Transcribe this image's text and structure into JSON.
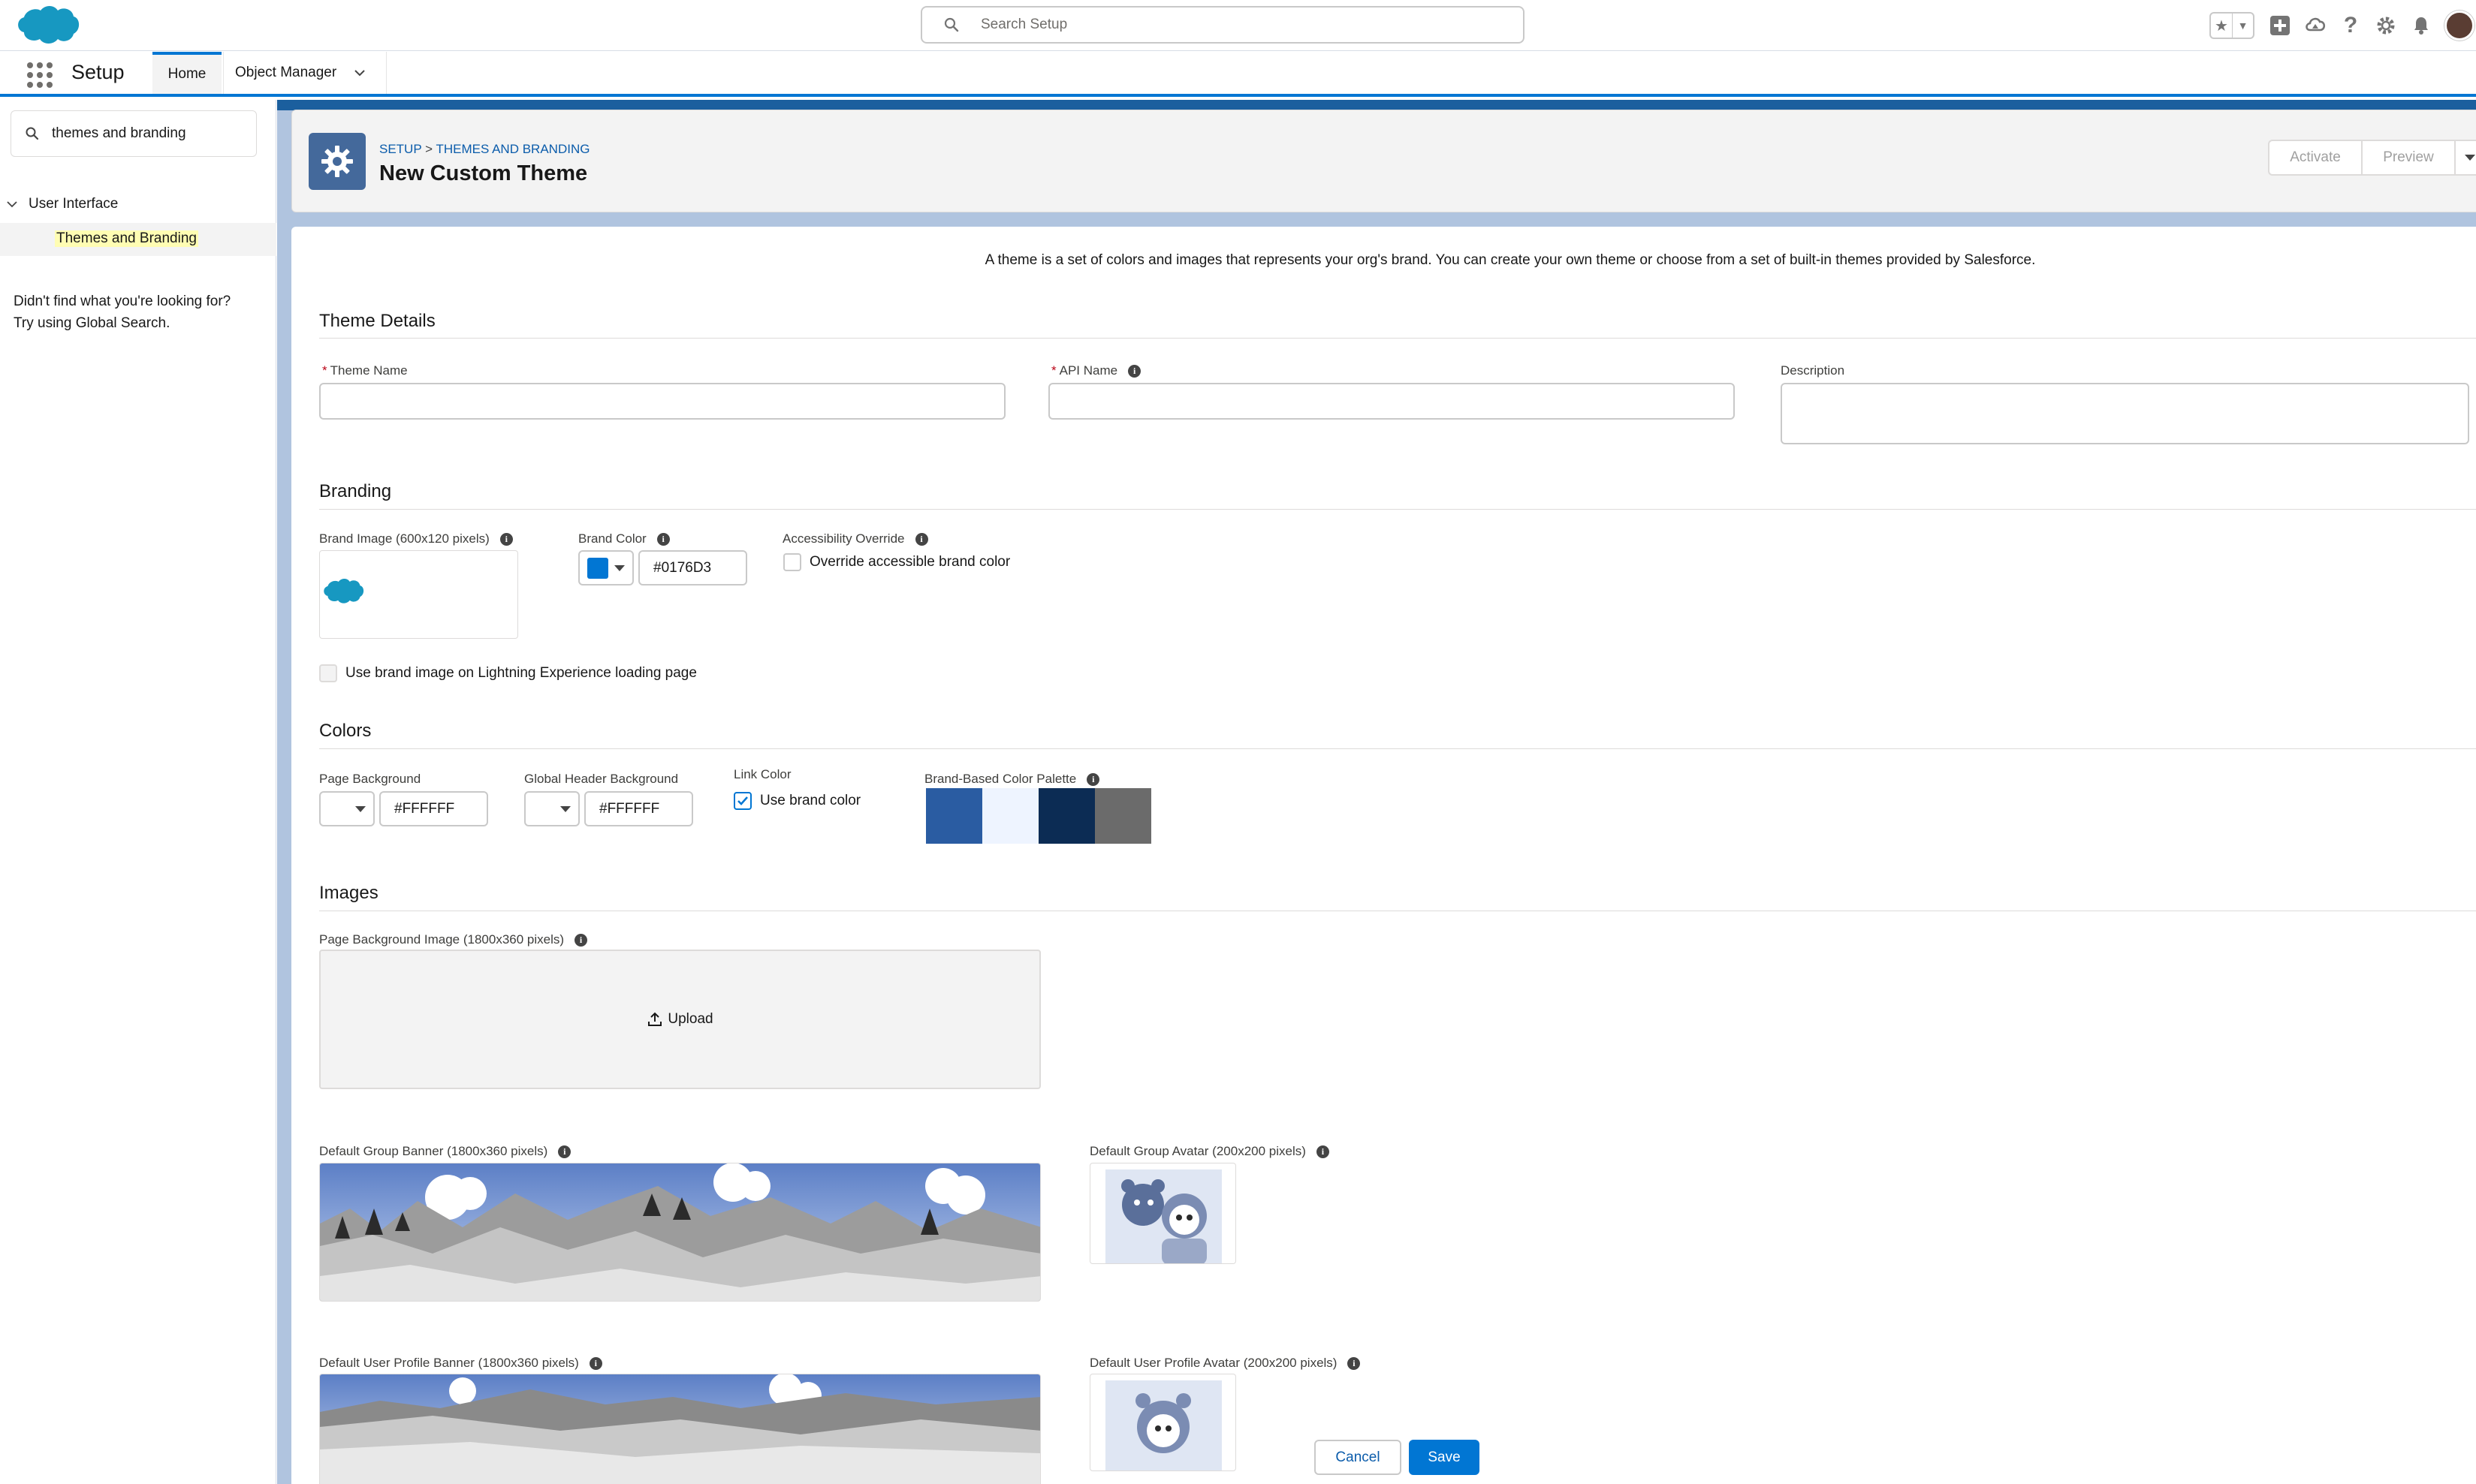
{
  "global_header": {
    "search_placeholder": "Search Setup",
    "icons": [
      "favorites-star-icon",
      "favorites-menu-icon",
      "global-actions-add-icon",
      "trailhead-guidance-icon",
      "help-icon",
      "setup-gear-icon",
      "notifications-bell-icon",
      "user-avatar"
    ]
  },
  "context_bar": {
    "app_name": "Setup",
    "tabs": [
      {
        "label": "Home",
        "active": true
      },
      {
        "label": "Object Manager",
        "active": false
      }
    ]
  },
  "sidebar": {
    "quick_find_value": "themes and branding",
    "tree": {
      "group_label": "User Interface",
      "item_label": "Themes and Branding"
    },
    "not_found_line1": "Didn't find what you're looking for?",
    "not_found_line2": "Try using Global Search."
  },
  "page_header": {
    "breadcrumb_root": "SETUP",
    "breadcrumb_sep": ">",
    "breadcrumb_page": "THEMES AND BRANDING",
    "title": "New Custom Theme",
    "buttons": {
      "activate": "Activate",
      "preview": "Preview"
    }
  },
  "intro_text": "A theme is a set of colors and images that represents your org's brand. You can create your own theme or choose from a set of built-in themes provided by Salesforce.",
  "theme_details": {
    "section_title": "Theme Details",
    "theme_name_label": "Theme Name",
    "theme_name_value": "",
    "api_name_label": "API Name",
    "api_name_value": "",
    "description_label": "Description",
    "required_marker": "*"
  },
  "branding": {
    "section_title": "Branding",
    "brand_image_label": "Brand Image (600x120 pixels)",
    "brand_color_label": "Brand Color",
    "brand_color_value": "#0176D3",
    "accessibility_label": "Accessibility Override",
    "override_label": "Override accessible brand color",
    "override_checked": false,
    "loading_page_label": "Use brand image on Lightning Experience loading page",
    "loading_page_checked": false
  },
  "colors": {
    "section_title": "Colors",
    "page_bg_label": "Page Background",
    "page_bg_value": "#FFFFFF",
    "header_bg_label": "Global Header Background",
    "header_bg_value": "#FFFFFF",
    "link_color_label": "Link Color",
    "use_brand_color_label": "Use brand color",
    "use_brand_color_checked": true,
    "palette_label": "Brand-Based Color Palette",
    "palette": [
      "#2a5ca2",
      "#eef4ff",
      "#0c2c54",
      "#6b6b6b"
    ]
  },
  "images": {
    "section_title": "Images",
    "page_bg_image_label": "Page Background Image (1800x360 pixels)",
    "upload_label": "Upload",
    "group_banner_label": "Default Group Banner (1800x360 pixels)",
    "group_avatar_label": "Default Group Avatar (200x200 pixels)",
    "profile_banner_label": "Default User Profile Banner (1800x360 pixels)",
    "profile_avatar_label": "Default User Profile Avatar (200x200 pixels)"
  },
  "footer": {
    "cancel": "Cancel",
    "save": "Save"
  },
  "colors_theme": {
    "brand": "#0176d3",
    "link": "#0b5cab",
    "required": "#ba0517"
  }
}
